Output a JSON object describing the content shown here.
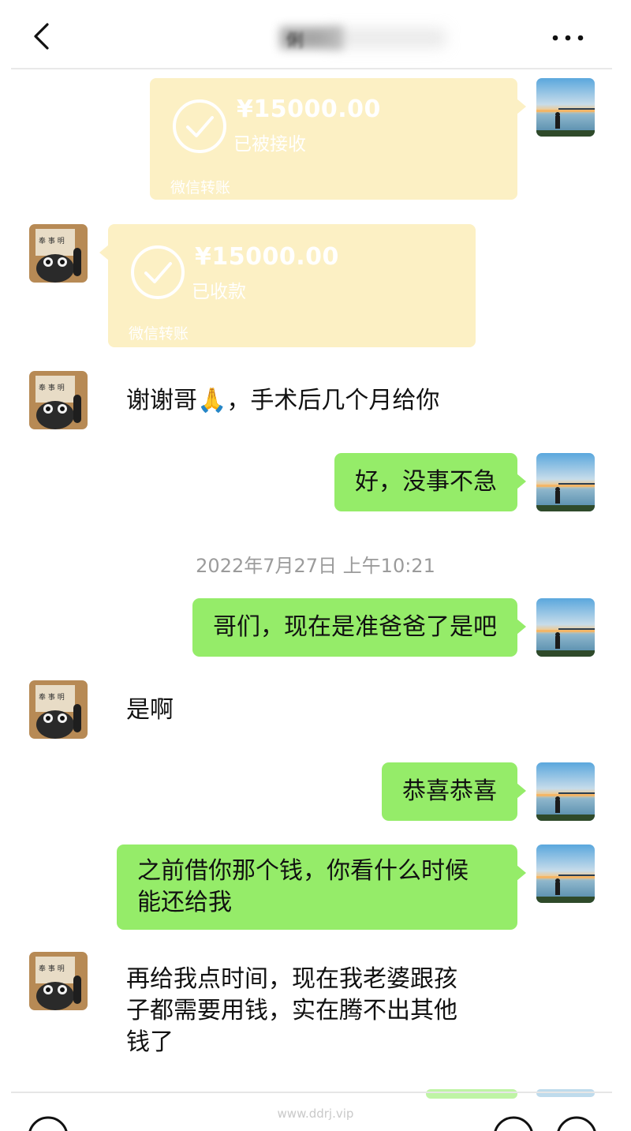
{
  "header": {
    "back_icon": "chevron-left-icon",
    "title": "俐",
    "more_icon": "ellipsis-icon"
  },
  "colors": {
    "sent_bubble": "#95ec69",
    "transfer_card": "#fcf0c4",
    "timestamp_text": "#9b9b9b",
    "background": "#ffffff"
  },
  "messages": [
    {
      "side": "right",
      "type": "transfer",
      "amount": "¥15000.00",
      "status": "已被接收",
      "footer": "微信转账"
    },
    {
      "side": "left",
      "type": "transfer",
      "amount": "¥15000.00",
      "status": "已收款",
      "footer": "微信转账"
    },
    {
      "side": "left",
      "type": "text",
      "text": "谢谢哥🙏，手术后几个月给你"
    },
    {
      "side": "right",
      "type": "text",
      "text": "好，没事不急"
    },
    {
      "type": "timestamp",
      "text": "2022年7月27日 上午10:21"
    },
    {
      "side": "right",
      "type": "text",
      "text": "哥们，现在是准爸爸了是吧"
    },
    {
      "side": "left",
      "type": "text",
      "text": "是啊"
    },
    {
      "side": "right",
      "type": "text",
      "text": "恭喜恭喜"
    },
    {
      "side": "right",
      "type": "text",
      "lines": [
        "之前借你那个钱，你看什么时候",
        "能还给我"
      ]
    },
    {
      "side": "left",
      "type": "text",
      "lines": [
        "再给我点时间，现在我老婆跟孩",
        "子都需要用钱，实在腾不出其他",
        "钱了"
      ]
    }
  ],
  "watermark": "www.ddrj.vip",
  "toolbar": {
    "voice_icon": "voice-icon",
    "emoji_icon": "emoji-icon",
    "plus_icon": "plus-icon"
  }
}
